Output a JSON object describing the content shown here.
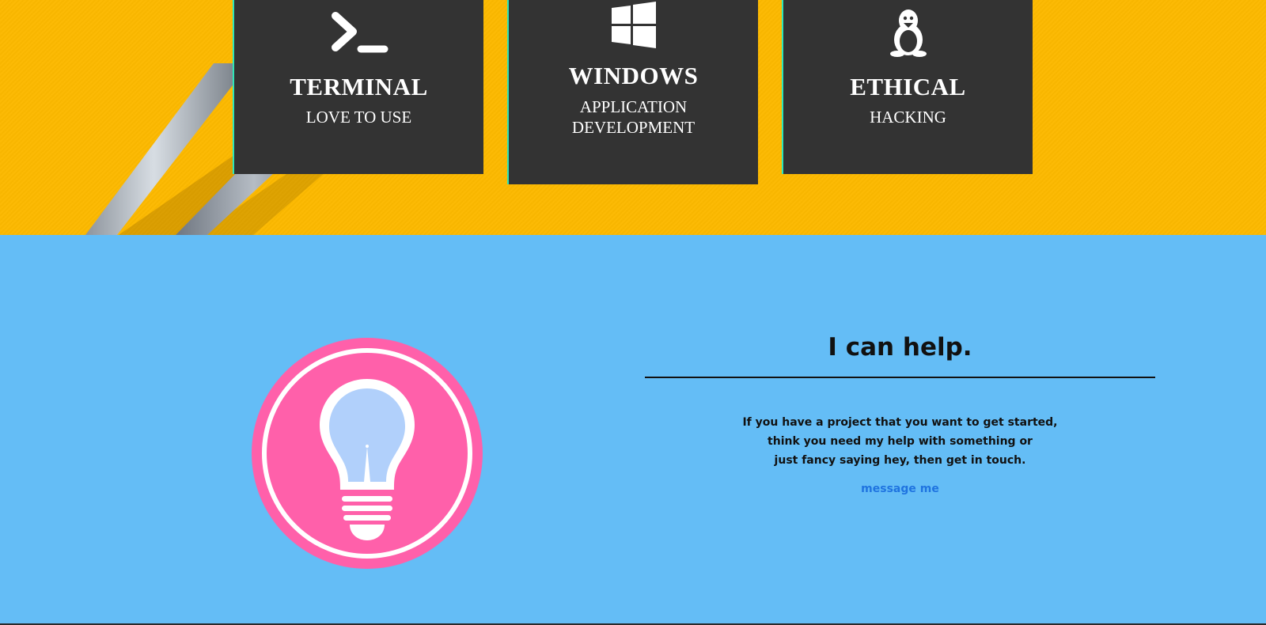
{
  "services": [
    {
      "title": "TERMINAL",
      "subtitle": [
        "LOVE TO USE"
      ],
      "icon": "terminal-icon"
    },
    {
      "title": "WINDOWS",
      "subtitle": [
        "APPLICATION",
        "DEVELOPMENT"
      ],
      "icon": "windows-logo-icon"
    },
    {
      "title": "ETHICAL",
      "subtitle": [
        "HACKING"
      ],
      "icon": "linux-penguin-icon"
    }
  ],
  "help": {
    "title": "I can help.",
    "text_lines": [
      "If you have a project that you want to get started,",
      "think you need my help with something or",
      "just fancy saying hey, then get in touch."
    ],
    "link_label": "message me",
    "icon": "lightbulb-icon"
  },
  "colors": {
    "hero_background": "#fcb900",
    "card_background": "#333333",
    "card_accent": "#2ee6b8",
    "help_background": "#64bdf6",
    "bulb_circle": "#ff60aa",
    "link": "#1f74e0"
  }
}
